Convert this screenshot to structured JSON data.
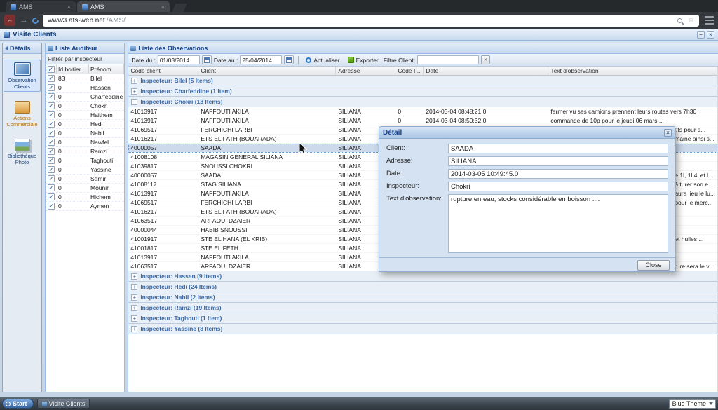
{
  "browser": {
    "tabs": [
      {
        "label": "AMS"
      },
      {
        "label": "AMS"
      }
    ],
    "url_host": "www3.ats-web.net",
    "url_path": "/AMS/"
  },
  "window": {
    "title": "Visite Clients",
    "minimize": "−",
    "close": "×"
  },
  "sidebar": {
    "header": "Détails",
    "items": [
      {
        "label": "Observation Clients",
        "active": true
      },
      {
        "label": "Actions Commerciale",
        "active": false
      },
      {
        "label": "Bibliothèque Photo",
        "active": false
      }
    ]
  },
  "auditors": {
    "title": "Liste Auditeur",
    "filter_label": "Filtrer par inspecteur",
    "columns": {
      "id": "Id boitier",
      "name": "Prénom"
    },
    "rows": [
      {
        "id": "83",
        "name": "Bilel",
        "checked": true
      },
      {
        "id": "0",
        "name": "Hassen",
        "checked": true
      },
      {
        "id": "0",
        "name": "Charfeddine",
        "checked": true
      },
      {
        "id": "0",
        "name": "Chokri",
        "checked": true
      },
      {
        "id": "0",
        "name": "Haithem",
        "checked": true
      },
      {
        "id": "0",
        "name": "Hedi",
        "checked": true
      },
      {
        "id": "0",
        "name": "Nabil",
        "checked": true
      },
      {
        "id": "0",
        "name": "Nawfel",
        "checked": true
      },
      {
        "id": "0",
        "name": "Ramzi",
        "checked": true
      },
      {
        "id": "0",
        "name": "Taghouti",
        "checked": true
      },
      {
        "id": "0",
        "name": "Yassine",
        "checked": true
      },
      {
        "id": "0",
        "name": "Samir",
        "checked": true
      },
      {
        "id": "0",
        "name": "Mounir",
        "checked": true
      },
      {
        "id": "0",
        "name": "Hichem",
        "checked": true
      },
      {
        "id": "0",
        "name": "Aymen",
        "checked": true
      }
    ]
  },
  "observations": {
    "title": "Liste des Observations",
    "toolbar": {
      "date_from_label": "Date du :",
      "date_from_value": "01/03/2014",
      "date_to_label": "Date au :",
      "date_to_value": "25/04/2014",
      "refresh_label": "Actualiser",
      "export_label": "Exporter",
      "filter_label": "Filtre Client:",
      "filter_value": "",
      "clear_label": "×"
    },
    "columns": [
      "Code client",
      "Client",
      "Adresse",
      "Code I...",
      "Date",
      "Text d'observation"
    ],
    "groups": [
      {
        "label": "Inspecteur: Bilel (5 Items)",
        "expanded": false,
        "rows": []
      },
      {
        "label": "Inspecteur: Charfeddine (1 Item)",
        "expanded": false,
        "rows": []
      },
      {
        "label": "Inspecteur: Chokri (18 Items)",
        "expanded": true,
        "rows": [
          {
            "code": "41013917",
            "client": "NAFFOUTI AKILA",
            "adresse": "SILIANA",
            "code_i": "0",
            "date": "2014-03-04 08:48:21.0",
            "text": "fermer vu ses camions prennent leurs routes vers 7h30"
          },
          {
            "code": "41013917",
            "client": "NAFFOUTI AKILA",
            "adresse": "SILIANA",
            "code_i": "0",
            "date": "2014-03-04 08:50:32.0",
            "text": "commande de 10p pour le jeudi 06 mars ..."
          },
          {
            "code": "41069517",
            "client": "FERCHICHI LARBI",
            "adresse": "SILIANA",
            "code_i": "",
            "date": "",
            "text": "tifs pour s...",
            "cut": true
          },
          {
            "code": "41016217",
            "client": "ETS EL FATH (BOUARADA)",
            "adresse": "SILIANA",
            "code_i": "",
            "date": "",
            "text": "maine ainsi s...",
            "cut": true
          },
          {
            "code": "40000057",
            "client": "SAADA",
            "adresse": "SILIANA",
            "code_i": "",
            "date": "",
            "text": "",
            "selected": true
          },
          {
            "code": "41008108",
            "client": "MAGASIN GENERAL SILIANA",
            "adresse": "SILIANA",
            "code_i": "",
            "date": "",
            "text": ""
          },
          {
            "code": "41039817",
            "client": "SNOUSSI CHOKRI",
            "adresse": "SILIANA",
            "code_i": "",
            "date": "",
            "text": ""
          },
          {
            "code": "40000057",
            "client": "SAADA",
            "adresse": "SILIANA",
            "code_i": "",
            "date": "",
            "text": "e 1l, 1l 4l et l...",
            "cut": true
          },
          {
            "code": "41008117",
            "client": "STAG SILIANA",
            "adresse": "SILIANA",
            "code_i": "",
            "date": "",
            "text": "â turer son e...",
            "cut": true
          },
          {
            "code": "41013917",
            "client": "NAFFOUTI AKILA",
            "adresse": "SILIANA",
            "code_i": "",
            "date": "",
            "text": "aura lieu le lu...",
            "cut": true
          },
          {
            "code": "41069517",
            "client": "FERCHICHI LARBI",
            "adresse": "SILIANA",
            "code_i": "",
            "date": "",
            "text": "pour le merc...",
            "cut": true
          },
          {
            "code": "41016217",
            "client": "ETS EL FATH (BOUARADA)",
            "adresse": "SILIANA",
            "code_i": "",
            "date": "",
            "text": ""
          },
          {
            "code": "41063517",
            "client": "ARFAOUI DZAIER",
            "adresse": "SILIANA",
            "code_i": "",
            "date": "",
            "text": ""
          },
          {
            "code": "40000044",
            "client": "HABIB SNOUSSI",
            "adresse": "SILIANA",
            "code_i": "",
            "date": "",
            "text": ""
          },
          {
            "code": "41001917",
            "client": "STE EL HANA (EL KRIB)",
            "adresse": "SILIANA",
            "code_i": "",
            "date": "",
            "text": "et huiles ...",
            "cut": true
          },
          {
            "code": "41001817",
            "client": "STE EL FETH",
            "adresse": "SILIANA",
            "code_i": "",
            "date": "",
            "text": ""
          },
          {
            "code": "41013917",
            "client": "NAFFOUTI AKILA",
            "adresse": "SILIANA",
            "code_i": "",
            "date": "",
            "text": ""
          },
          {
            "code": "41063517",
            "client": "ARFAOUI DZAIER",
            "adresse": "SILIANA",
            "code_i": "",
            "date": "",
            "text": "ture sera le v...",
            "cut": true
          }
        ]
      },
      {
        "label": "Inspecteur: Hassen (9 Items)",
        "expanded": false,
        "rows": []
      },
      {
        "label": "Inspecteur: Hedi (24 Items)",
        "expanded": false,
        "rows": []
      },
      {
        "label": "Inspecteur: Nabil (2 Items)",
        "expanded": false,
        "rows": []
      },
      {
        "label": "Inspecteur: Ramzi (19 Items)",
        "expanded": false,
        "rows": []
      },
      {
        "label": "Inspecteur: Taghouti (1 Item)",
        "expanded": false,
        "rows": []
      },
      {
        "label": "Inspecteur: Yassine (8 Items)",
        "expanded": false,
        "rows": []
      }
    ]
  },
  "dialog": {
    "title": "Détail",
    "close_icon": "×",
    "fields": [
      {
        "label": "Client:",
        "value": "SAADA"
      },
      {
        "label": "Adresse:",
        "value": "SILIANA"
      },
      {
        "label": "Date:",
        "value": "2014-03-05 10:49:45.0"
      },
      {
        "label": "Inspecteur:",
        "value": "Chokri"
      }
    ],
    "textarea_label": "Text d'observation:",
    "textarea_value": "rupture en eau,  stocks considérable en boisson ....",
    "close_label": "Close"
  },
  "taskbar": {
    "start_label": "Start",
    "task_label": "Visite Clients",
    "theme_label": "Blue Theme"
  },
  "colors": {
    "accent_blue": "#15428b",
    "panel_border": "#99bbe8",
    "selection": "#ccdaeb",
    "group_text": "#3a6aa8"
  }
}
